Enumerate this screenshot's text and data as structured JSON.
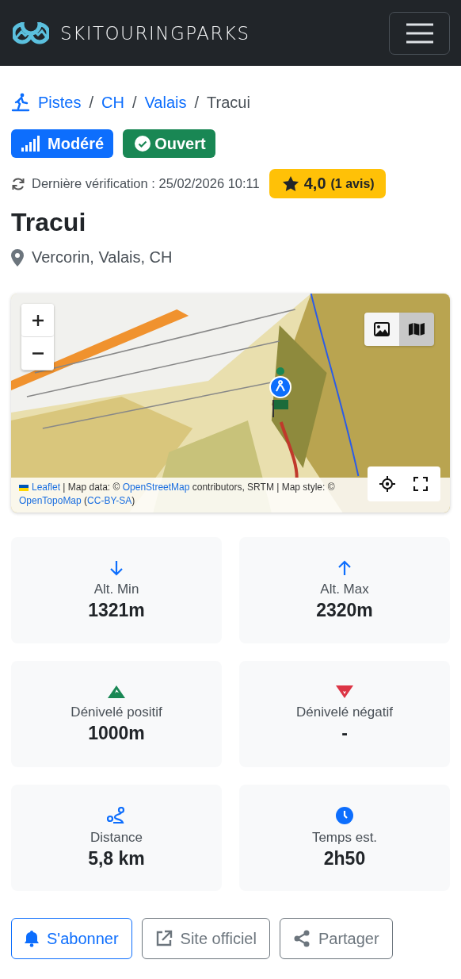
{
  "navbar": {
    "brand": "SKITOURINGPARKS"
  },
  "breadcrumb": [
    {
      "kind": "link",
      "label": "Pistes"
    },
    {
      "kind": "separator",
      "label": "/"
    },
    {
      "kind": "link",
      "label": "CH"
    },
    {
      "kind": "separator",
      "label": "/"
    },
    {
      "kind": "link",
      "label": "Valais"
    },
    {
      "kind": "separator",
      "label": "/"
    },
    {
      "kind": "current",
      "label": "Tracui"
    }
  ],
  "badges": [
    {
      "kind": "difficulty",
      "label": "Modéré"
    },
    {
      "kind": "status",
      "label": "Ouvert"
    }
  ],
  "verification": "Dernière vérification : 25/02/2026 10:11",
  "rating": {
    "score": "4,0",
    "count": "(1 avis)"
  },
  "title": "Tracui",
  "location": "Vercorin, Valais, CH",
  "map": {
    "kind": "picture",
    "layers": [
      {
        "kind": "satellite",
        "selected": false
      },
      {
        "kind": "topo",
        "selected": true
      }
    ],
    "attribution": [
      {
        "kind": "link",
        "text": "Leaflet"
      },
      {
        "kind": "text",
        "text": " | Map data: © "
      },
      {
        "kind": "link",
        "text": "OpenStreetMap"
      },
      {
        "kind": "text",
        "text": " contributors, SRTM | Map style: ©"
      }
    ],
    "attribution_line2": [
      {
        "kind": "link",
        "text": "OpenTopoMap"
      },
      {
        "kind": "text",
        "text": " ("
      },
      {
        "kind": "link",
        "text": "CC-BY-SA"
      },
      {
        "kind": "text",
        "text": ")"
      }
    ]
  },
  "stats": [
    {
      "kind": "down",
      "label": "Alt. Min",
      "value": "1321m"
    },
    {
      "kind": "up",
      "label": "Alt. Max",
      "value": "2320m"
    },
    {
      "kind": "gain",
      "label": "Dénivelé positif",
      "value": "1000m"
    },
    {
      "kind": "loss",
      "label": "Dénivelé négatif",
      "value": "-"
    },
    {
      "kind": "distance",
      "label": "Distance",
      "value": "5,8 km"
    },
    {
      "kind": "time",
      "label": "Temps est.",
      "value": "2h50"
    }
  ],
  "actions": [
    {
      "kind": "subscribe",
      "label": "S'abonner"
    },
    {
      "kind": "external",
      "label": "Site officiel"
    },
    {
      "kind": "share",
      "label": "Partager"
    }
  ]
}
